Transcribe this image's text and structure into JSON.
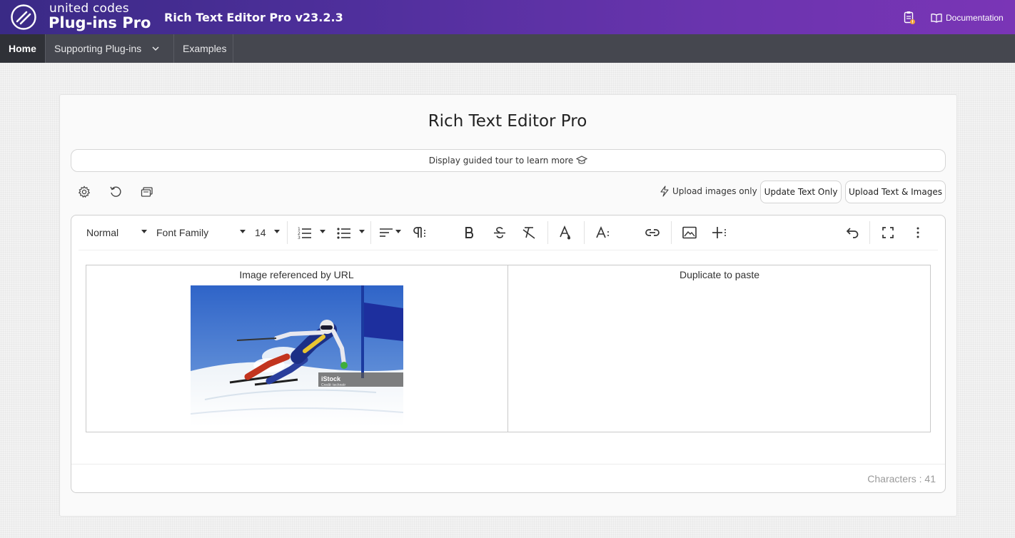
{
  "header": {
    "brand_line1": "united codes",
    "brand_line2": "Plug-ins Pro",
    "app_title": "Rich Text Editor Pro v23.2.3",
    "documentation_label": "Documentation"
  },
  "nav": {
    "items": [
      {
        "label": "Home",
        "active": true
      },
      {
        "label": "Supporting Plug-ins",
        "has_dropdown": true
      },
      {
        "label": "Examples"
      }
    ]
  },
  "page": {
    "title": "Rich Text Editor Pro",
    "tour_label": "Display guided tour to learn more",
    "upload_images_only": "Upload images only",
    "update_text_only": "Update Text Only",
    "upload_text_images": "Upload Text & Images"
  },
  "editor": {
    "toolbar": {
      "block_format": "Normal",
      "font_family": "Font Family",
      "font_size": "14"
    },
    "table": {
      "cells": [
        {
          "caption": "Image referenced by URL"
        },
        {
          "caption": "Duplicate to paste"
        }
      ],
      "image_watermark": "iStock",
      "image_credit": "Credit: technotr"
    },
    "character_count_label": "Characters : 41"
  },
  "colors": {
    "header_gradient_start": "#3a2a86",
    "header_gradient_end": "#7a35b6",
    "nav_bg": "#45474f",
    "nav_active_bg": "#2f3137"
  }
}
